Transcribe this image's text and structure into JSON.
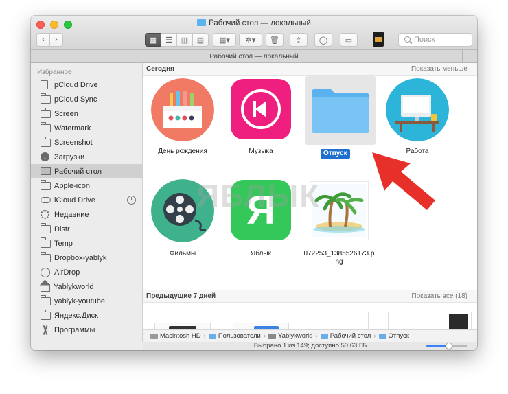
{
  "window": {
    "title": "Рабочий стол — локальный",
    "tab_title": "Рабочий стол — локальный"
  },
  "toolbar": {
    "search_placeholder": "Поиск"
  },
  "sidebar": {
    "header": "Избранное",
    "items": [
      {
        "label": "pCloud Drive",
        "icon": "folder-icon"
      },
      {
        "label": "pCloud Sync",
        "icon": "folder-icon"
      },
      {
        "label": "Screen",
        "icon": "folder-icon"
      },
      {
        "label": "Watermark",
        "icon": "folder-icon"
      },
      {
        "label": "Screenshot",
        "icon": "folder-icon"
      },
      {
        "label": "Загрузки",
        "icon": "downloads-icon"
      },
      {
        "label": "Рабочий стол",
        "icon": "desktop-icon"
      },
      {
        "label": "Apple-icon",
        "icon": "folder-icon"
      },
      {
        "label": "iCloud Drive",
        "icon": "cloud-icon"
      },
      {
        "label": "Недавние",
        "icon": "recents-icon"
      },
      {
        "label": "Distr",
        "icon": "folder-icon"
      },
      {
        "label": "Temp",
        "icon": "folder-icon"
      },
      {
        "label": "Dropbox-yablyk",
        "icon": "folder-icon"
      },
      {
        "label": "AirDrop",
        "icon": "airdrop-icon"
      },
      {
        "label": "Yablykworld",
        "icon": "home-icon"
      },
      {
        "label": "yablyk-youtube",
        "icon": "folder-icon"
      },
      {
        "label": "Яндекс.Диск",
        "icon": "folder-icon"
      },
      {
        "label": "Программы",
        "icon": "applications-icon"
      }
    ]
  },
  "sections": {
    "today": {
      "title": "Сегодня",
      "action": "Показать меньше"
    },
    "prev7": {
      "title": "Предыдущие 7 дней",
      "action": "Показать все (18)"
    }
  },
  "files": [
    {
      "label": "День рождения"
    },
    {
      "label": "Музыка"
    },
    {
      "label": "Отпуск"
    },
    {
      "label": "Работа"
    },
    {
      "label": "Фильмы"
    },
    {
      "label": "Яблык",
      "glyph": "Я"
    },
    {
      "label": "072253_1385526173.p\nng"
    }
  ],
  "pathbar": [
    "Macintosh HD",
    "Пользователи",
    "Yablykworld",
    "Рабочий стол",
    "Отпуск"
  ],
  "status": {
    "text": "Выбрано 1 из 149; доступно 50,63 ГБ",
    "zoom_level": 0.55
  },
  "watermark": "ЯБЛЫК",
  "colors": {
    "selection": "#1f6fd1",
    "folder": "#5ab2ef",
    "arrow": "#e8302a"
  }
}
